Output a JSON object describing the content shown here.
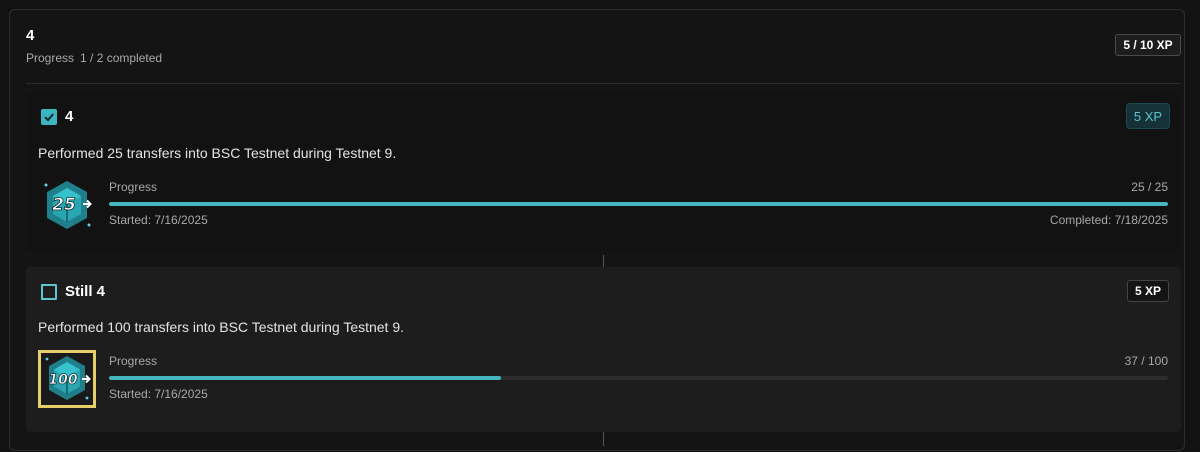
{
  "header": {
    "title": "4",
    "progress_label": "Progress",
    "progress_count": "1 / 2 completed",
    "xp": "5 / 10 XP"
  },
  "quests": [
    {
      "title": "4",
      "completed": true,
      "xp": "5 XP",
      "description": "Performed 25 transfers into BSC Testnet during Testnet 9.",
      "badge_text": "25",
      "progress_label": "Progress",
      "progress_value": "25 / 25",
      "progress_fraction": 1.0,
      "started": "Started: 7/16/2025",
      "completed_on": "Completed: 7/18/2025"
    },
    {
      "title": "Still 4",
      "completed": false,
      "xp": "5 XP",
      "description": "Performed 100 transfers into BSC Testnet during Testnet 9.",
      "badge_text": "100",
      "progress_label": "Progress",
      "progress_value": "37 / 100",
      "progress_fraction": 0.37,
      "started": "Started: 7/16/2025"
    }
  ],
  "colors": {
    "accent": "#46b7c1",
    "badge_gold": "#e6cf6a"
  }
}
